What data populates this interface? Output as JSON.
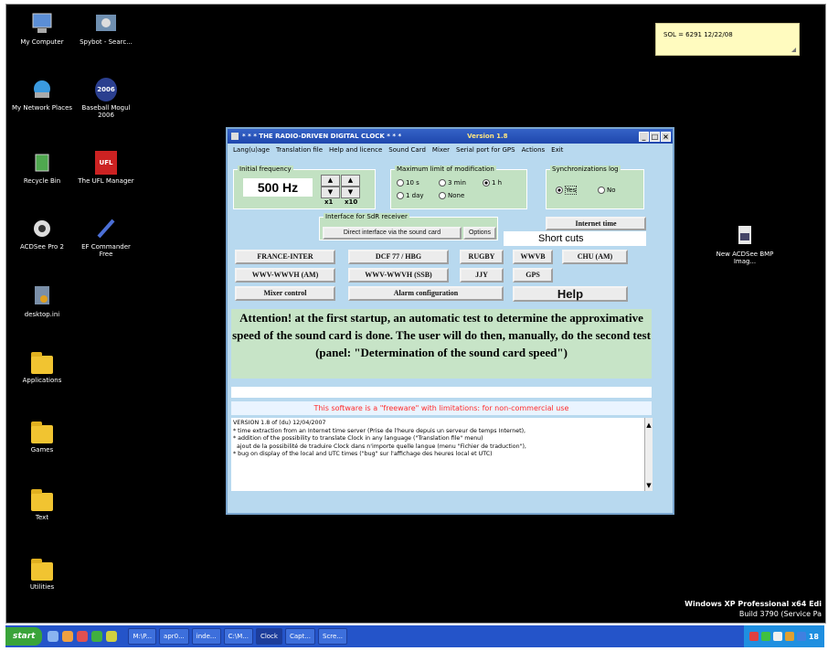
{
  "desktop": {
    "icons_left": [
      {
        "label": "My Computer",
        "icon": "computer-icon"
      },
      {
        "label": "Spybot - Searc...",
        "icon": "spybot-icon"
      },
      {
        "label": "My Network Places",
        "icon": "network-icon"
      },
      {
        "label": "Baseball Mogul 2006",
        "icon": "baseball-icon",
        "badge": "2006"
      },
      {
        "label": "Recycle Bin",
        "icon": "recycle-bin-icon"
      },
      {
        "label": "The UFL Manager",
        "icon": "ufl-icon",
        "badge": "UFL"
      },
      {
        "label": "ACDSee Pro 2",
        "icon": "acdsee-icon"
      },
      {
        "label": "EF Commander Free",
        "icon": "ef-commander-icon"
      },
      {
        "label": "desktop.ini",
        "icon": "ini-file-icon"
      },
      {
        "label": "Applications",
        "icon": "folder-icon"
      },
      {
        "label": "Games",
        "icon": "folder-icon"
      },
      {
        "label": "Text",
        "icon": "folder-icon"
      },
      {
        "label": "Utilities",
        "icon": "folder-icon"
      }
    ],
    "icon_right": {
      "label": "New ACDSee BMP Imag...",
      "icon": "bmp-file-icon"
    },
    "sticky_note": "SOL = 6291 12/22/08",
    "os_version_line1": "Windows XP Professional x64 Edi",
    "os_version_line2": "Build 3790 (Service Pa"
  },
  "app": {
    "title": "* * * THE RADIO-DRIVEN DIGITAL CLOCK * * *",
    "version": "Version 1.8",
    "window_buttons": [
      "_",
      "□",
      "×"
    ],
    "menu": [
      "Lang(u)age",
      "Translation file",
      "Help and licence",
      "Sound Card",
      "Mixer",
      "Serial port for GPS",
      "Actions",
      "Exit"
    ],
    "initial_frequency": {
      "label": "Initial frequency",
      "value": "500 Hz",
      "up": "▲",
      "down": "▼",
      "mult1": "x1",
      "mult10": "x10"
    },
    "max_modification": {
      "label": "Maximum limit of modification",
      "options": [
        "10 s",
        "3 min",
        "1 h",
        "1 day",
        "None"
      ],
      "selected": "1 h"
    },
    "sync_log": {
      "label": "Synchronizations log",
      "options": [
        "Yes",
        "No"
      ],
      "selected": "Yes"
    },
    "sdr": {
      "label": "Interface for SdR receiver",
      "direct": "Direct interface via the sound card",
      "options": "Options"
    },
    "internet_time": "Internet time",
    "short_cuts": "Short cuts",
    "stations_row1": [
      "FRANCE-INTER",
      "DCF 77 / HBG",
      "RUGBY",
      "WWVB",
      "CHU (AM)"
    ],
    "stations_row2": [
      "WWV-WWVH (AM)",
      "WWV-WWVH (SSB)",
      "JJY",
      "GPS"
    ],
    "mixer_control": "Mixer control",
    "alarm_configuration": "Alarm configuration",
    "help": "Help",
    "attention": "Attention! at the first startup,  an automatic test to determine the approximative speed of the sound card is done. The user will do then, manually, do the second test (panel: \"Determination of the sound card speed\")",
    "freeware_notice": "This software is a \"freeware\" with limitations: for non-commercial use",
    "log_lines": [
      "VERSION 1.8 of (du) 12/04/2007",
      "* time extraction from an Internet time server (Prise de l'heure depuis un serveur de temps Internet),",
      "* addition of the possibility to translate Clock in any language (\"Translation file\" menu)",
      "  ajout de la possibilité de traduire Clock dans n'importe quelle langue (menu \"Fichier de traduction\"),",
      "* bug on display of the local and UTC times (\"bug\" sur l'affichage des heures local et UTC)"
    ]
  },
  "taskbar": {
    "start": "start",
    "tasks": [
      "M:\\P...",
      "apr0...",
      "inde...",
      "C:\\M...",
      "Clock",
      "Capt...",
      "Scre..."
    ],
    "active_task": "Clock",
    "clock": "18"
  },
  "colors": {
    "desktop": "#000000",
    "window_bg": "#b8d9ef",
    "panel_green": "#c7e4c7",
    "titlebar": "#2a55bd",
    "freeware_red": "#ff2b2b"
  }
}
